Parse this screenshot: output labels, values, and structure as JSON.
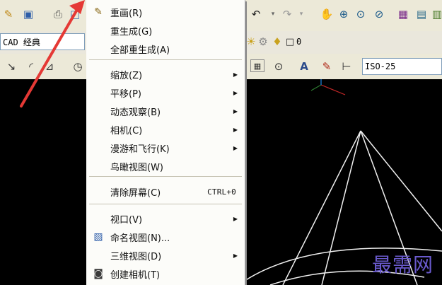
{
  "toolbar": {
    "workspace": "CAD 经典",
    "layer_value": "0",
    "dim_style": "ISO-25"
  },
  "menu": {
    "items": [
      {
        "label": "重画(R)",
        "has_icon": true,
        "icon": "pencil-icon"
      },
      {
        "label": "重生成(G)"
      },
      {
        "label": "全部重生成(A)"
      },
      {
        "label": "缩放(Z)",
        "submenu": true
      },
      {
        "label": "平移(P)",
        "submenu": true
      },
      {
        "label": "动态观察(B)",
        "submenu": true
      },
      {
        "label": "相机(C)",
        "submenu": true
      },
      {
        "label": "漫游和飞行(K)",
        "submenu": true
      },
      {
        "label": "鸟瞰视图(W)"
      },
      {
        "label": "清除屏幕(C)",
        "shortcut": "CTRL+0"
      },
      {
        "label": "视口(V)",
        "submenu": true
      },
      {
        "label": "命名视图(N)...",
        "icon": "named-view-icon"
      },
      {
        "label": "三维视图(D)",
        "submenu": true
      },
      {
        "label": "创建相机(T)",
        "icon": "camera-icon"
      }
    ],
    "submenu_arrow": "▶"
  },
  "watermark": "最需网",
  "colors": {
    "menu_bg": "#FCFCF9",
    "toolbar_bg": "#ECE9D8",
    "canvas_bg": "#000000",
    "wireframe": "#FFFFFF",
    "annotation_arrow": "#E53935",
    "watermark": "#6A5ACD"
  }
}
